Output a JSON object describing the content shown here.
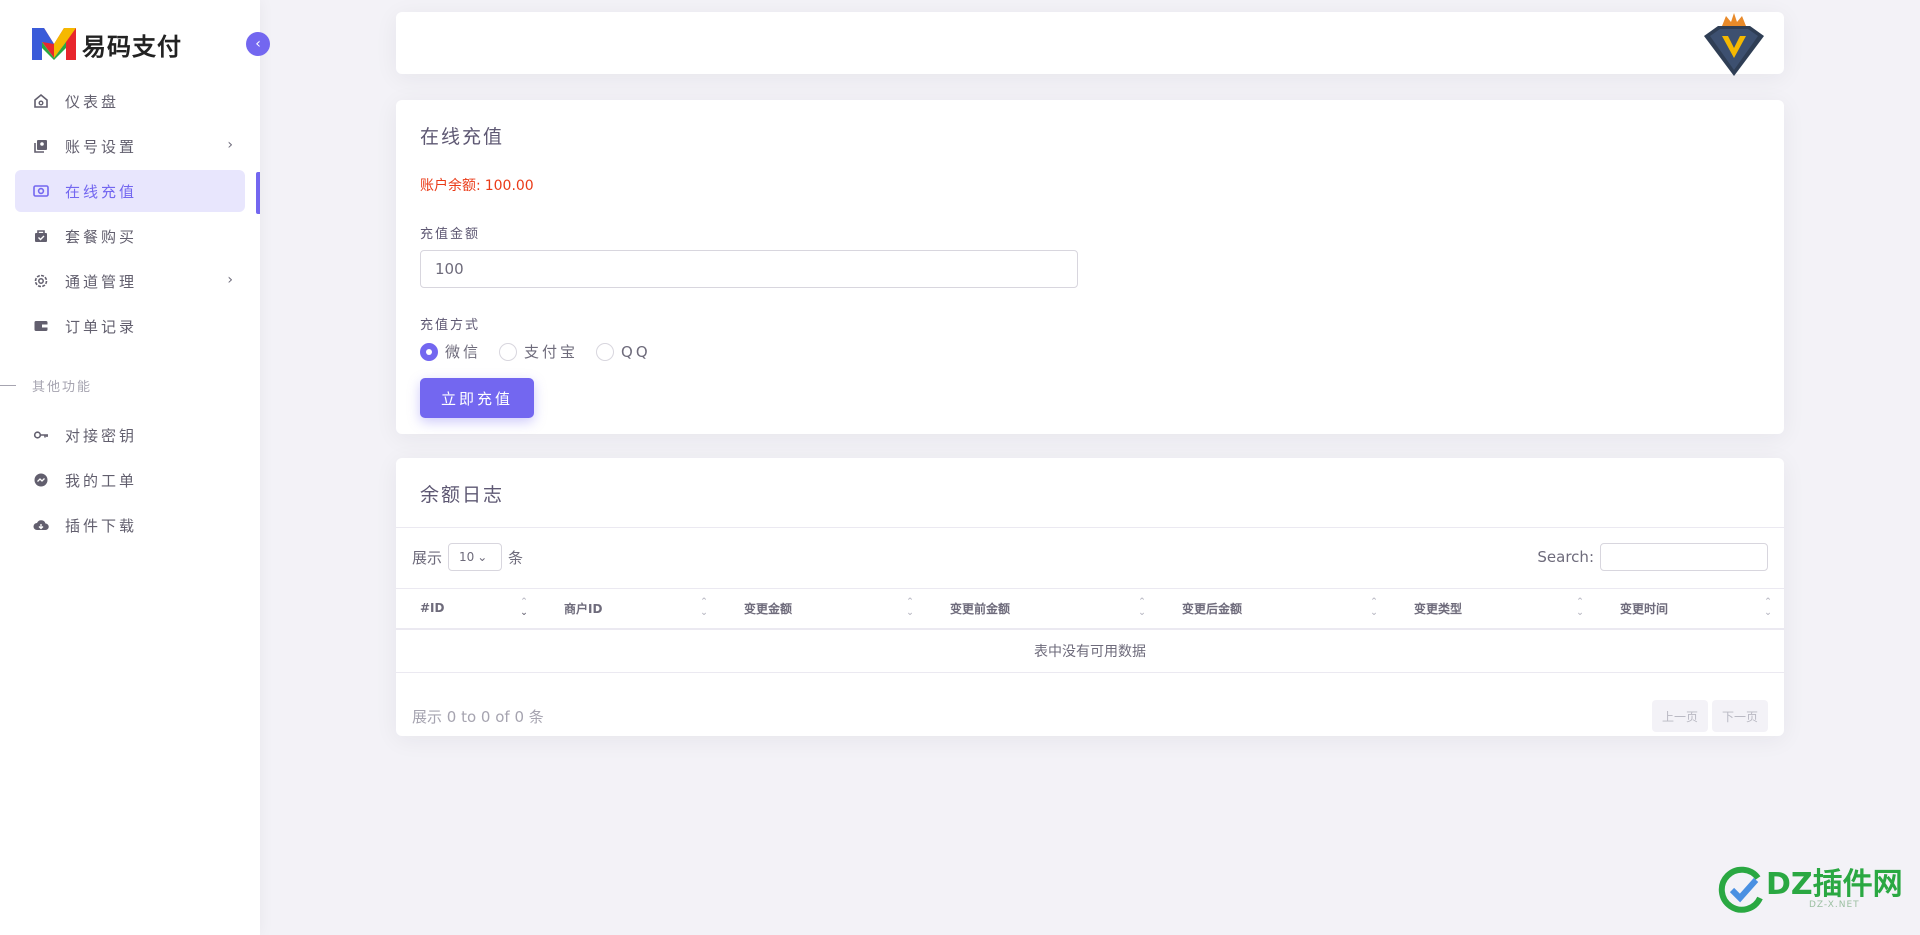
{
  "brand": {
    "name": "易码支付"
  },
  "sidebar": {
    "items": [
      {
        "label": "仪表盘",
        "icon": "home-icon"
      },
      {
        "label": "账号设置",
        "icon": "profile-icon",
        "has_children": true
      },
      {
        "label": "在线充值",
        "icon": "recharge-icon",
        "active": true
      },
      {
        "label": "套餐购买",
        "icon": "shopping-bag-icon"
      },
      {
        "label": "通道管理",
        "icon": "gear-icon",
        "has_children": true
      },
      {
        "label": "订单记录",
        "icon": "wallet-icon"
      }
    ],
    "section_header": "其他功能",
    "items2": [
      {
        "label": "对接密钥",
        "icon": "key-icon"
      },
      {
        "label": "我的工单",
        "icon": "chat-icon"
      },
      {
        "label": "插件下载",
        "icon": "cloud-download-icon"
      }
    ]
  },
  "recharge": {
    "title": "在线充值",
    "balance_label": "账户余额:",
    "balance_value": "100.00",
    "amount_label": "充值金额",
    "amount_value": "100",
    "method_label": "充值方式",
    "methods": [
      "微信",
      "支付宝",
      "QQ"
    ],
    "selected_method": "微信",
    "submit_label": "立即充值"
  },
  "log": {
    "title": "余额日志",
    "show_prefix": "展示",
    "page_size": "10",
    "show_suffix": "条",
    "search_label": "Search:",
    "columns": [
      "#ID",
      "商户ID",
      "变更金额",
      "变更前金额",
      "变更后金额",
      "变更类型",
      "变更时间"
    ],
    "empty_text": "表中没有可用数据",
    "info": "展示 0 to 0 of 0 条",
    "prev": "上一页",
    "next": "下一页"
  },
  "watermark": {
    "text": "DZ插件网",
    "sub": "DZ-X.NET"
  },
  "colors": {
    "accent": "#7367f0",
    "balance": "#ea3b18",
    "watermark": "#2aa842"
  }
}
